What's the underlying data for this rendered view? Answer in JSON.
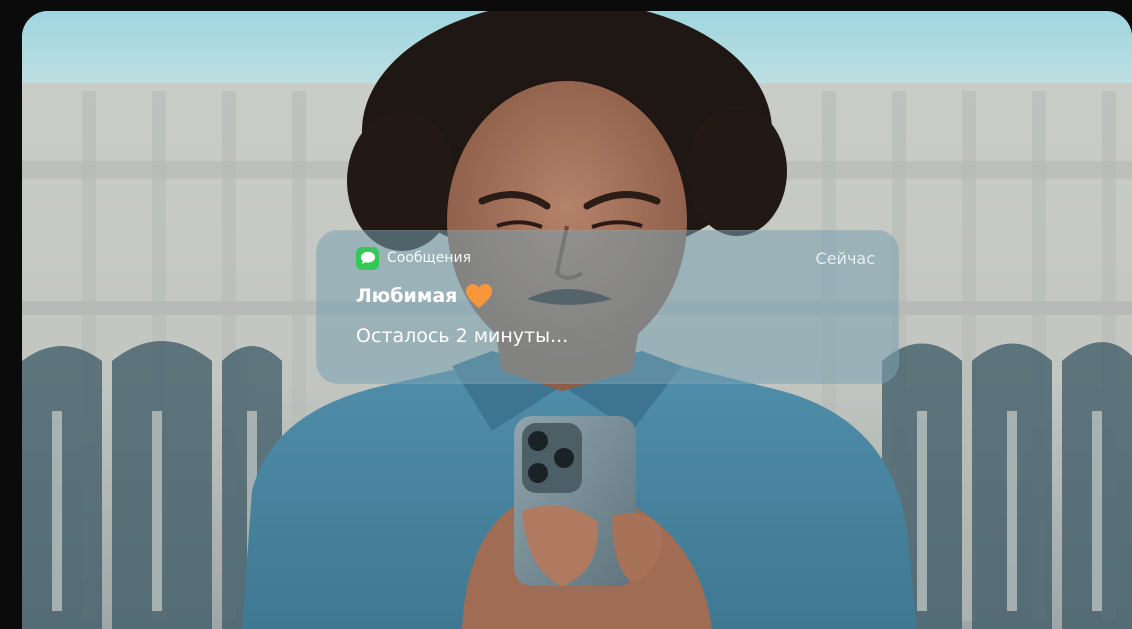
{
  "notification": {
    "app_icon": "messages-bubble-icon",
    "app_name": "Сообщения",
    "time": "Сейчас",
    "sender": "Любимая",
    "sender_emoji_icon": "orange-heart-icon",
    "message": "Осталось 2 минуты..."
  },
  "colors": {
    "messages_green": "#34c759",
    "heart_orange": "#f7963a"
  }
}
